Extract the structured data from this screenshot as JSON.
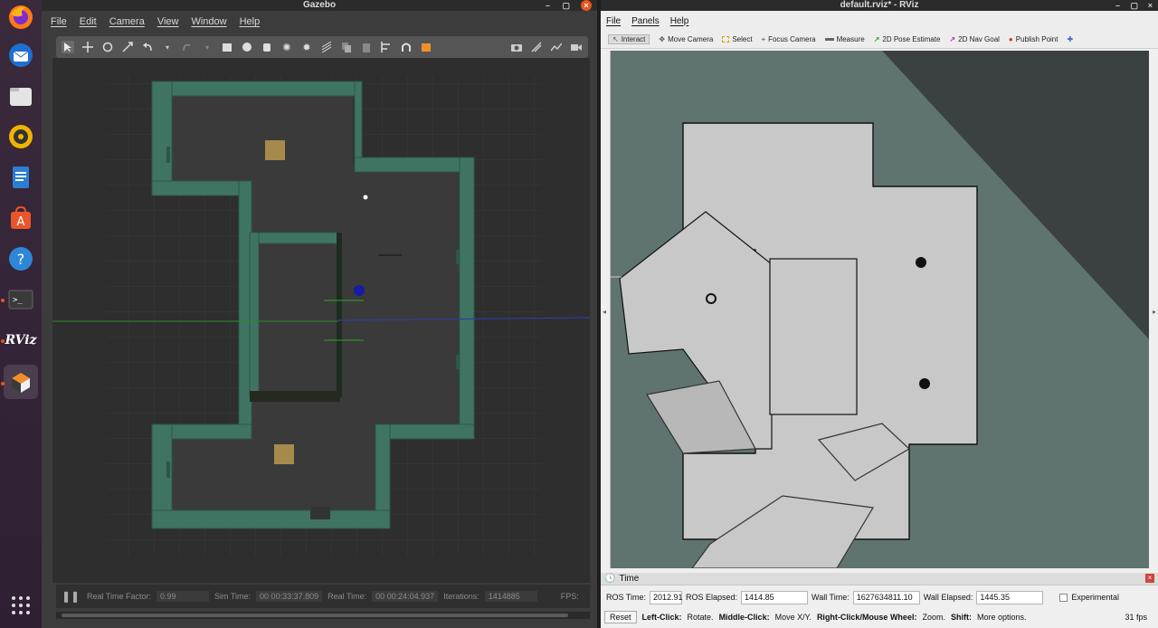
{
  "dock": {
    "items": [
      {
        "name": "firefox-icon"
      },
      {
        "name": "thunderbird-icon"
      },
      {
        "name": "files-icon"
      },
      {
        "name": "rhythmbox-icon"
      },
      {
        "name": "writer-icon"
      },
      {
        "name": "software-icon"
      },
      {
        "name": "help-icon"
      },
      {
        "name": "terminal-icon"
      },
      {
        "name": "rviz-icon",
        "label": "RViz"
      },
      {
        "name": "gazebo-icon"
      }
    ]
  },
  "gazebo": {
    "title": "Gazebo",
    "menu": [
      "File",
      "Edit",
      "Camera",
      "View",
      "Window",
      "Help"
    ],
    "status": {
      "real_time_factor_label": "Real Time Factor:",
      "real_time_factor": "0.99",
      "sim_time_label": "Sim Time:",
      "sim_time": "00 00:33:37.809",
      "real_time_label": "Real Time:",
      "real_time": "00 00:24:04.937",
      "iterations_label": "Iterations:",
      "iterations": "1414885",
      "fps_label": "FPS:"
    }
  },
  "rviz": {
    "title": "default.rviz* - RViz",
    "menu": [
      "File",
      "Panels",
      "Help"
    ],
    "tools": [
      "Interact",
      "Move Camera",
      "Select",
      "Focus Camera",
      "Measure",
      "2D Pose Estimate",
      "2D Nav Goal",
      "Publish Point"
    ],
    "time_panel": {
      "title": "Time",
      "ros_time_label": "ROS Time:",
      "ros_time": "2012.91",
      "ros_elapsed_label": "ROS Elapsed:",
      "ros_elapsed": "1414.85",
      "wall_time_label": "Wall Time:",
      "wall_time": "1627634811.10",
      "wall_elapsed_label": "Wall Elapsed:",
      "wall_elapsed": "1445.35",
      "experimental_label": "Experimental"
    },
    "help": {
      "reset_label": "Reset",
      "left_click": "Left-Click:",
      "left_click_desc": "Rotate.",
      "middle_click": "Middle-Click:",
      "middle_click_desc": "Move X/Y.",
      "right_click": "Right-Click/Mouse Wheel:",
      "right_click_desc": "Zoom.",
      "shift": "Shift:",
      "shift_desc": "More options.",
      "fps": "31 fps"
    }
  },
  "colors": {
    "wall": "#3f7463",
    "floor": "#3a3a3a",
    "box": "#a58a4c",
    "map_free": "#c8c8c8",
    "map_unknown": "#5f7470"
  }
}
